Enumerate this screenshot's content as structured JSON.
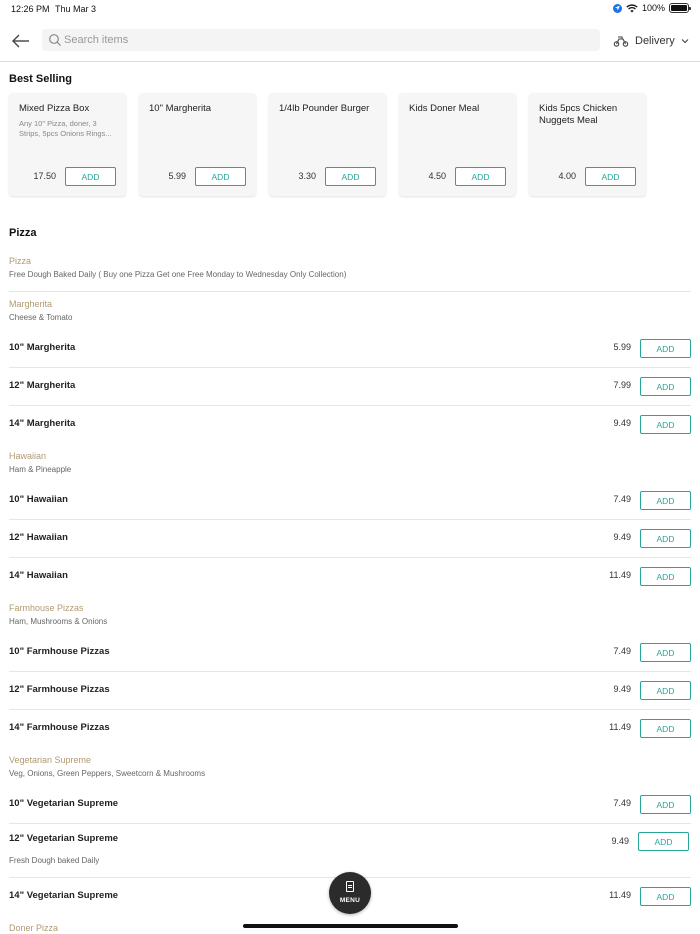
{
  "status_bar": {
    "time": "12:26 PM",
    "date": "Thu Mar 3",
    "battery": "100%",
    "icons": [
      "location-icon",
      "wifi-icon",
      "battery-icon"
    ]
  },
  "header": {
    "search_placeholder": "Search items",
    "search_value": "",
    "delivery_label": "Delivery",
    "icons": [
      "back-arrow-icon",
      "search-icon",
      "scooter-icon",
      "chevron-down-icon"
    ]
  },
  "best_selling": {
    "title": "Best Selling",
    "add_label": "ADD",
    "items": [
      {
        "name": "Mixed Pizza Box",
        "description": "Any 10\" Pizza, doner, 3 Strips, 5pcs Onions Rings...",
        "price": "17.50"
      },
      {
        "name": "10\" Margherita",
        "description": "",
        "price": "5.99"
      },
      {
        "name": "1/4lb Pounder Burger",
        "description": "",
        "price": "3.30"
      },
      {
        "name": "Kids Doner Meal",
        "description": "",
        "price": "4.50"
      },
      {
        "name": "Kids 5pcs Chicken Nuggets Meal",
        "description": "",
        "price": "4.00"
      }
    ]
  },
  "menu": {
    "section_title": "Pizza",
    "add_label": "ADD",
    "intro": {
      "name": "Pizza",
      "description": "Free Dough Baked Daily ( Buy one Pizza Get one Free Monday to Wednesday Only Collection)"
    },
    "groups": [
      {
        "name": "Margherita",
        "description": "Cheese & Tomato",
        "items": [
          {
            "name": "10\" Margherita",
            "price": "5.99"
          },
          {
            "name": "12\" Margherita",
            "price": "7.99"
          },
          {
            "name": "14\" Margherita",
            "price": "9.49"
          }
        ]
      },
      {
        "name": "Hawaiian",
        "description": "Ham & Pineapple",
        "items": [
          {
            "name": "10\" Hawaiian",
            "price": "7.49"
          },
          {
            "name": "12\" Hawaiian",
            "price": "9.49"
          },
          {
            "name": "14\" Hawaiian",
            "price": "11.49"
          }
        ]
      },
      {
        "name": "Farmhouse Pizzas",
        "description": "Ham, Mushrooms & Onions",
        "items": [
          {
            "name": "10\" Farmhouse Pizzas",
            "price": "7.49"
          },
          {
            "name": "12\" Farmhouse Pizzas",
            "price": "9.49"
          },
          {
            "name": "14\" Farmhouse Pizzas",
            "price": "11.49"
          }
        ]
      },
      {
        "name": "Vegetarian Supreme",
        "description": "Veg, Onions, Green Peppers, Sweetcorn & Mushrooms",
        "items": [
          {
            "name": "10\" Vegetarian Supreme",
            "price": "7.49"
          },
          {
            "name": "12\" Vegetarian Supreme",
            "price": "9.49",
            "note": "Fresh Dough baked Daily"
          },
          {
            "name": "14\" Vegetarian Supreme",
            "price": "11.49"
          }
        ]
      },
      {
        "name": "Doner Pizza",
        "description": "",
        "items": []
      }
    ]
  },
  "menu_button": {
    "label": "MENU",
    "icon": "menu-document-icon"
  },
  "colors": {
    "accent": "#26a69a",
    "group_name": "#b09a72",
    "fab_background": "#2b2b2b"
  }
}
